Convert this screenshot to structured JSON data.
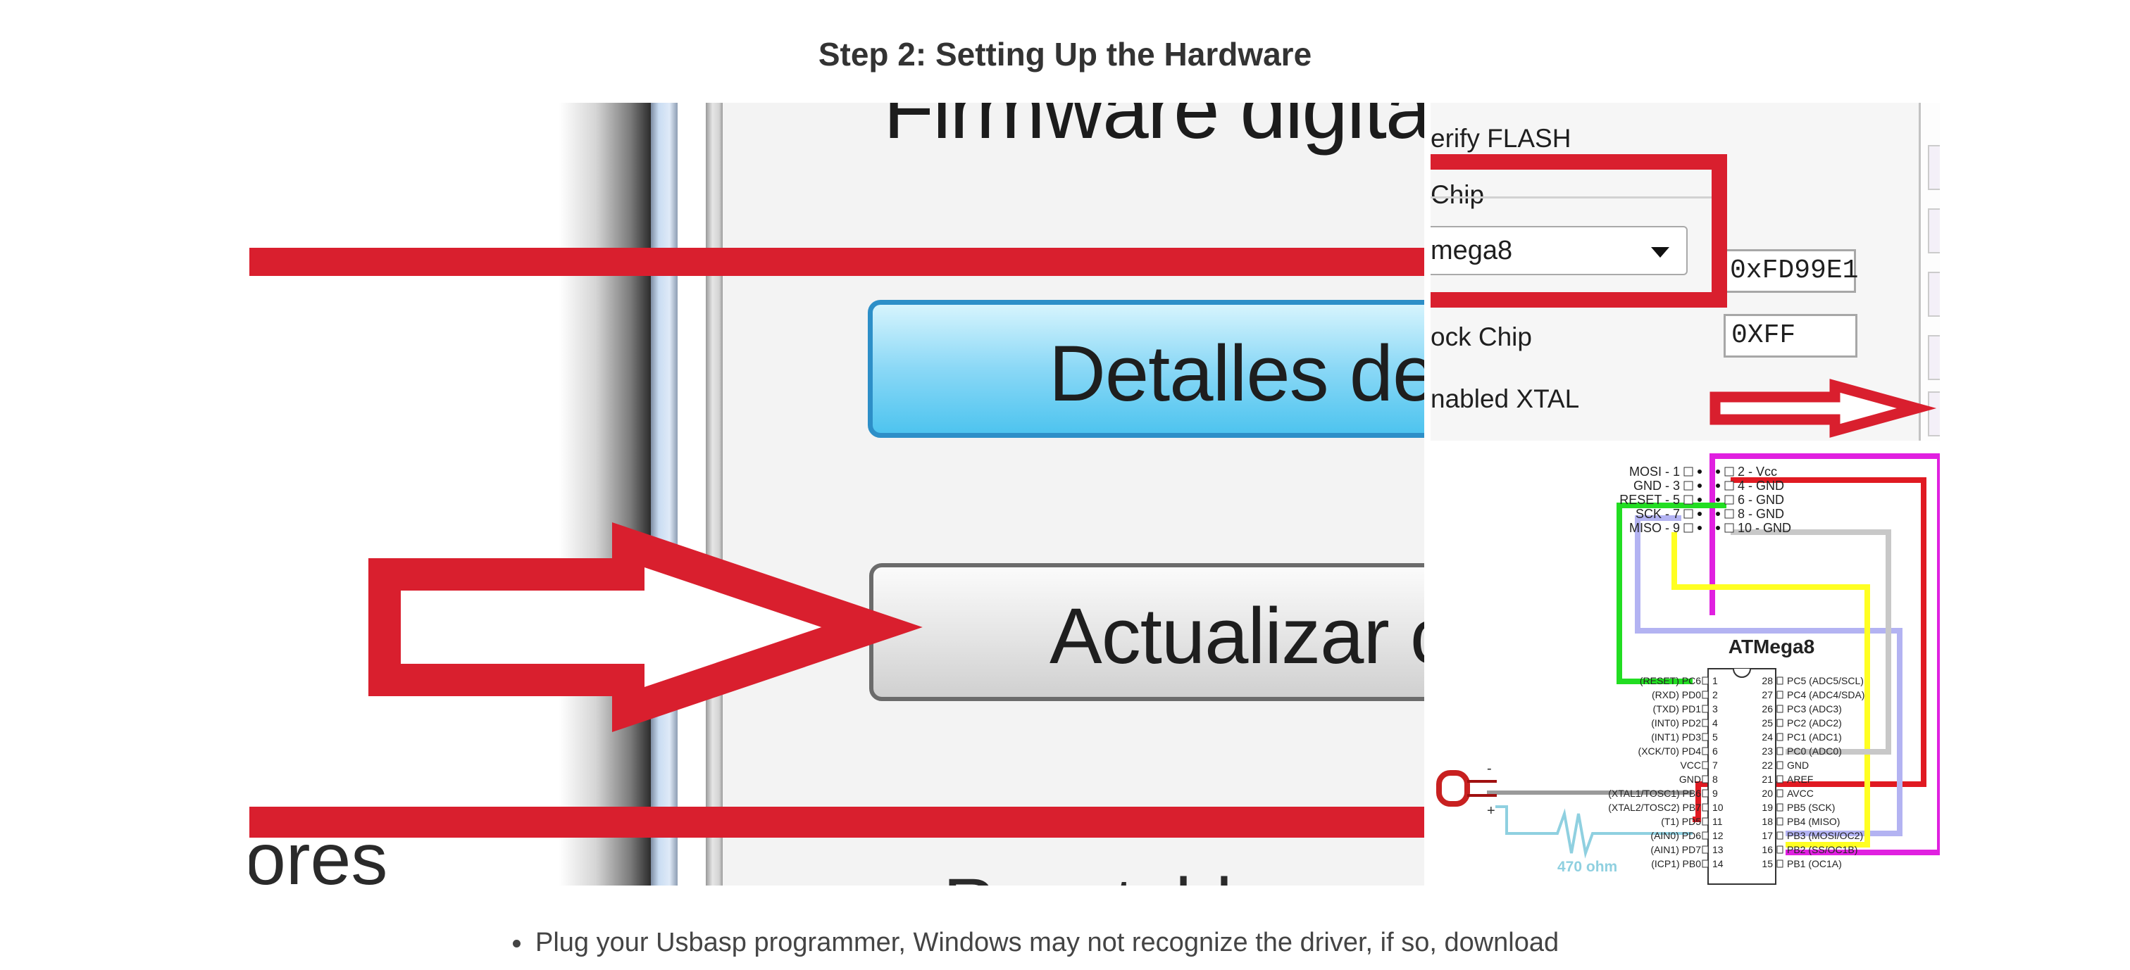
{
  "step": {
    "title": "Step 2: Setting Up the Hardware"
  },
  "zoom_panel": {
    "heading_fragment": "Firmware digital.",
    "button_1_fragment": "Detalles de",
    "button_2_fragment": "Actualizar c",
    "footer_fragment": "ores",
    "partial_text": "Reestable"
  },
  "settings_panel": {
    "verify_label": "erify FLASH",
    "chip_group_label": "Chip",
    "chip_value": "mega8",
    "lock_label": "ock Chip",
    "xtal_label": "nabled XTAL",
    "fuse_value": "0xFD99E1",
    "lock_value": "0XFF"
  },
  "wiring_diagram": {
    "header_left": [
      "MOSI - 1",
      "GND - 3",
      "RESET - 5",
      "SCK - 7",
      "MISO - 9"
    ],
    "header_right": [
      "2 - Vcc",
      "4 - GND",
      "6 - GND",
      "8 - GND",
      "10 - GND"
    ],
    "chip_name": "ATMega8",
    "pins_left": [
      {
        "label": "(RESET) PC6",
        "num": "1"
      },
      {
        "label": "(RXD) PD0",
        "num": "2"
      },
      {
        "label": "(TXD) PD1",
        "num": "3"
      },
      {
        "label": "(INT0) PD2",
        "num": "4"
      },
      {
        "label": "(INT1) PD3",
        "num": "5"
      },
      {
        "label": "(XCK/T0) PD4",
        "num": "6"
      },
      {
        "label": "VCC",
        "num": "7"
      },
      {
        "label": "GND",
        "num": "8"
      },
      {
        "label": "(XTAL1/TOSC1) PB6",
        "num": "9"
      },
      {
        "label": "(XTAL2/TOSC2) PB7",
        "num": "10"
      },
      {
        "label": "(T1) PD5",
        "num": "11"
      },
      {
        "label": "(AIN0) PD6",
        "num": "12"
      },
      {
        "label": "(AIN1) PD7",
        "num": "13"
      },
      {
        "label": "(ICP1) PB0",
        "num": "14"
      }
    ],
    "pins_right": [
      {
        "num": "28",
        "label": "PC5 (ADC5/SCL)"
      },
      {
        "num": "27",
        "label": "PC4 (ADC4/SDA)"
      },
      {
        "num": "26",
        "label": "PC3 (ADC3)"
      },
      {
        "num": "25",
        "label": "PC2 (ADC2)"
      },
      {
        "num": "24",
        "label": "PC1 (ADC1)"
      },
      {
        "num": "23",
        "label": "PC0 (ADC0)"
      },
      {
        "num": "22",
        "label": "GND"
      },
      {
        "num": "21",
        "label": "AREF"
      },
      {
        "num": "20",
        "label": "AVCC"
      },
      {
        "num": "19",
        "label": "PB5 (SCK)"
      },
      {
        "num": "18",
        "label": "PB4 (MISO)"
      },
      {
        "num": "17",
        "label": "PB3 (MOSI/OC2)"
      },
      {
        "num": "16",
        "label": "PB2 (SS/OC1B)"
      },
      {
        "num": "15",
        "label": "PB1 (OC1A)"
      }
    ],
    "resistor_label": "470 ohm",
    "led_minus": "-",
    "led_plus": "+",
    "wire_colors": {
      "mosi": "#e020e0",
      "vcc": "#e01a22",
      "reset": "#22dd22",
      "sck": "#b3b3f2",
      "miso": "#ffff22",
      "gnd": "#c8c8c8",
      "led": "#8fd0e0"
    }
  },
  "bullets": [
    "Plug your Usbasp programmer, Windows may not recognize the driver, if so, download"
  ],
  "colors": {
    "accent_red": "#d91f2e",
    "text": "#333333"
  }
}
